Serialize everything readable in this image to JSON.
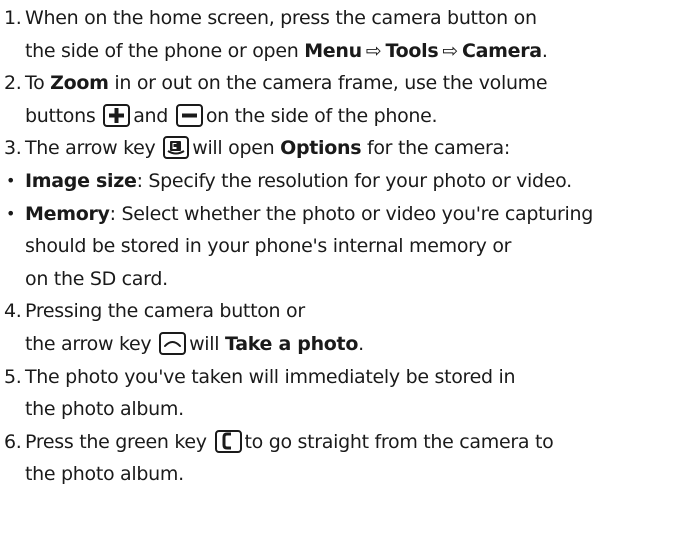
{
  "steps": {
    "s1": {
      "num": "1.",
      "line1": "When on the home screen, press the camera button on",
      "line2_pre": "the side of the phone or open ",
      "menu": "Menu",
      "arrow1": "⇨",
      "tools": "Tools",
      "arrow2": "⇨",
      "camera": "Camera",
      "line2_end": "."
    },
    "s2": {
      "num": "2.",
      "line1_pre": "To ",
      "zoom": "Zoom",
      "line1_post": " in or out on the camera frame, use the volume",
      "line2_pre": "buttons",
      "and": "and",
      "line2_post": "on the side of the phone."
    },
    "s3": {
      "num": "3.",
      "pre": "The arrow key",
      "mid": "will open ",
      "options": "Options",
      "post": " for the camera:"
    },
    "b1": {
      "bullet": "•",
      "label": "Image size",
      "text": ": Specify the resolution for your photo or video."
    },
    "b2": {
      "bullet": "•",
      "label": "Memory",
      "line1": ": Select whether the photo or video you're capturing",
      "line2": "should be stored in your phone's internal memory or",
      "line3": "on the SD card."
    },
    "s4": {
      "num": "4.",
      "line1": "Pressing the camera button or",
      "line2_pre": "the arrow key",
      "line2_mid": "will ",
      "take": "Take a photo",
      "line2_end": "."
    },
    "s5": {
      "num": "5.",
      "line1": "The photo you've taken will immediately be stored in",
      "line2": "the photo album."
    },
    "s6": {
      "num": "6.",
      "line1_pre": "Press the green key",
      "line1_post": "to go straight from the camera to",
      "line2": "the photo album."
    }
  },
  "icons": {
    "plus": "plus-key-icon",
    "minus": "minus-key-icon",
    "options": "options-key-icon",
    "up": "up-arrow-key-icon",
    "call": "green-call-key-icon"
  },
  "colors": {
    "text": "#1a1a1a",
    "background": "#ffffff"
  }
}
